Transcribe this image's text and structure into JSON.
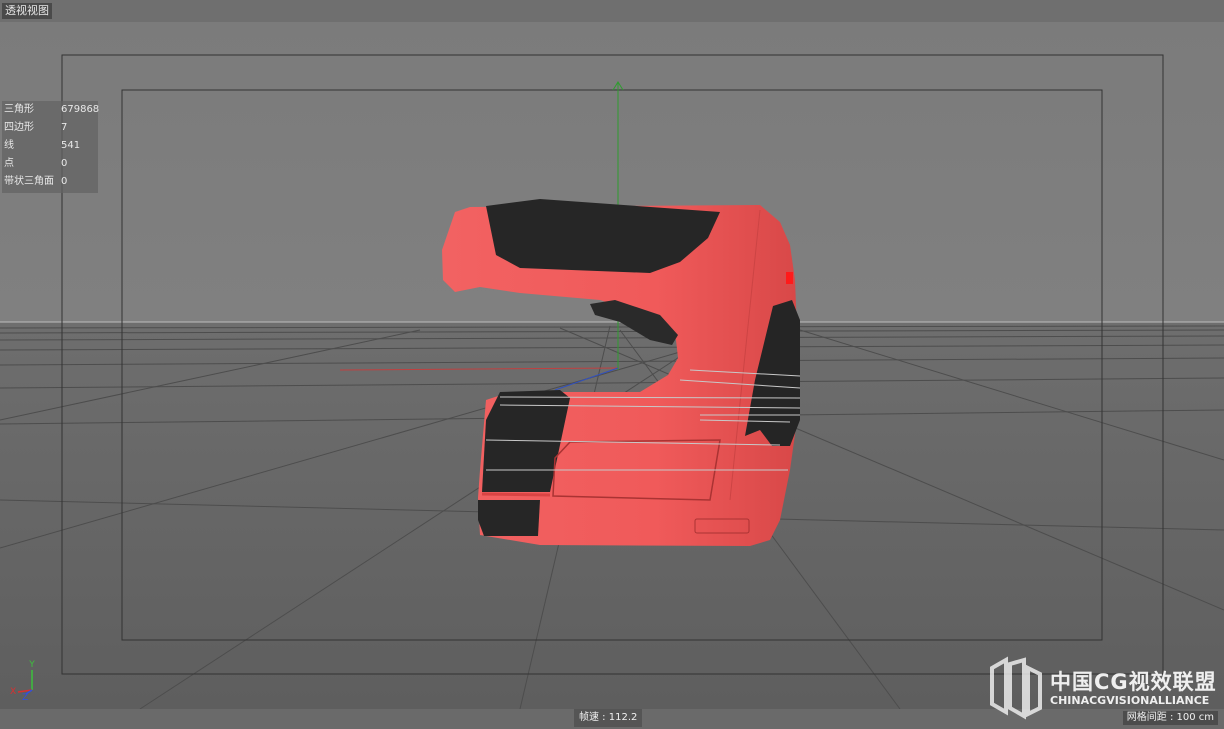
{
  "viewport": {
    "title": "透视视图"
  },
  "stats": [
    {
      "label": "三角形",
      "value": "679868"
    },
    {
      "label": "四边形",
      "value": "7"
    },
    {
      "label": "线",
      "value": "541"
    },
    {
      "label": "点",
      "value": "0"
    },
    {
      "label": "带状三角面",
      "value": "0"
    }
  ],
  "footer": {
    "fps": "帧速 : 112.2",
    "grid_spacing": "网格间距 : 100 cm"
  },
  "watermark": {
    "cn": "中国CG视效联盟",
    "en": "CHINACGVISIONALLIANCE"
  },
  "axis_labels": {
    "x": "X",
    "y": "Y",
    "z": "Z"
  },
  "colors": {
    "model_body": "#f05a5a",
    "model_grip": "#262626",
    "axis_x": "#e03030",
    "axis_y": "#30c030",
    "axis_z": "#3050e0"
  }
}
